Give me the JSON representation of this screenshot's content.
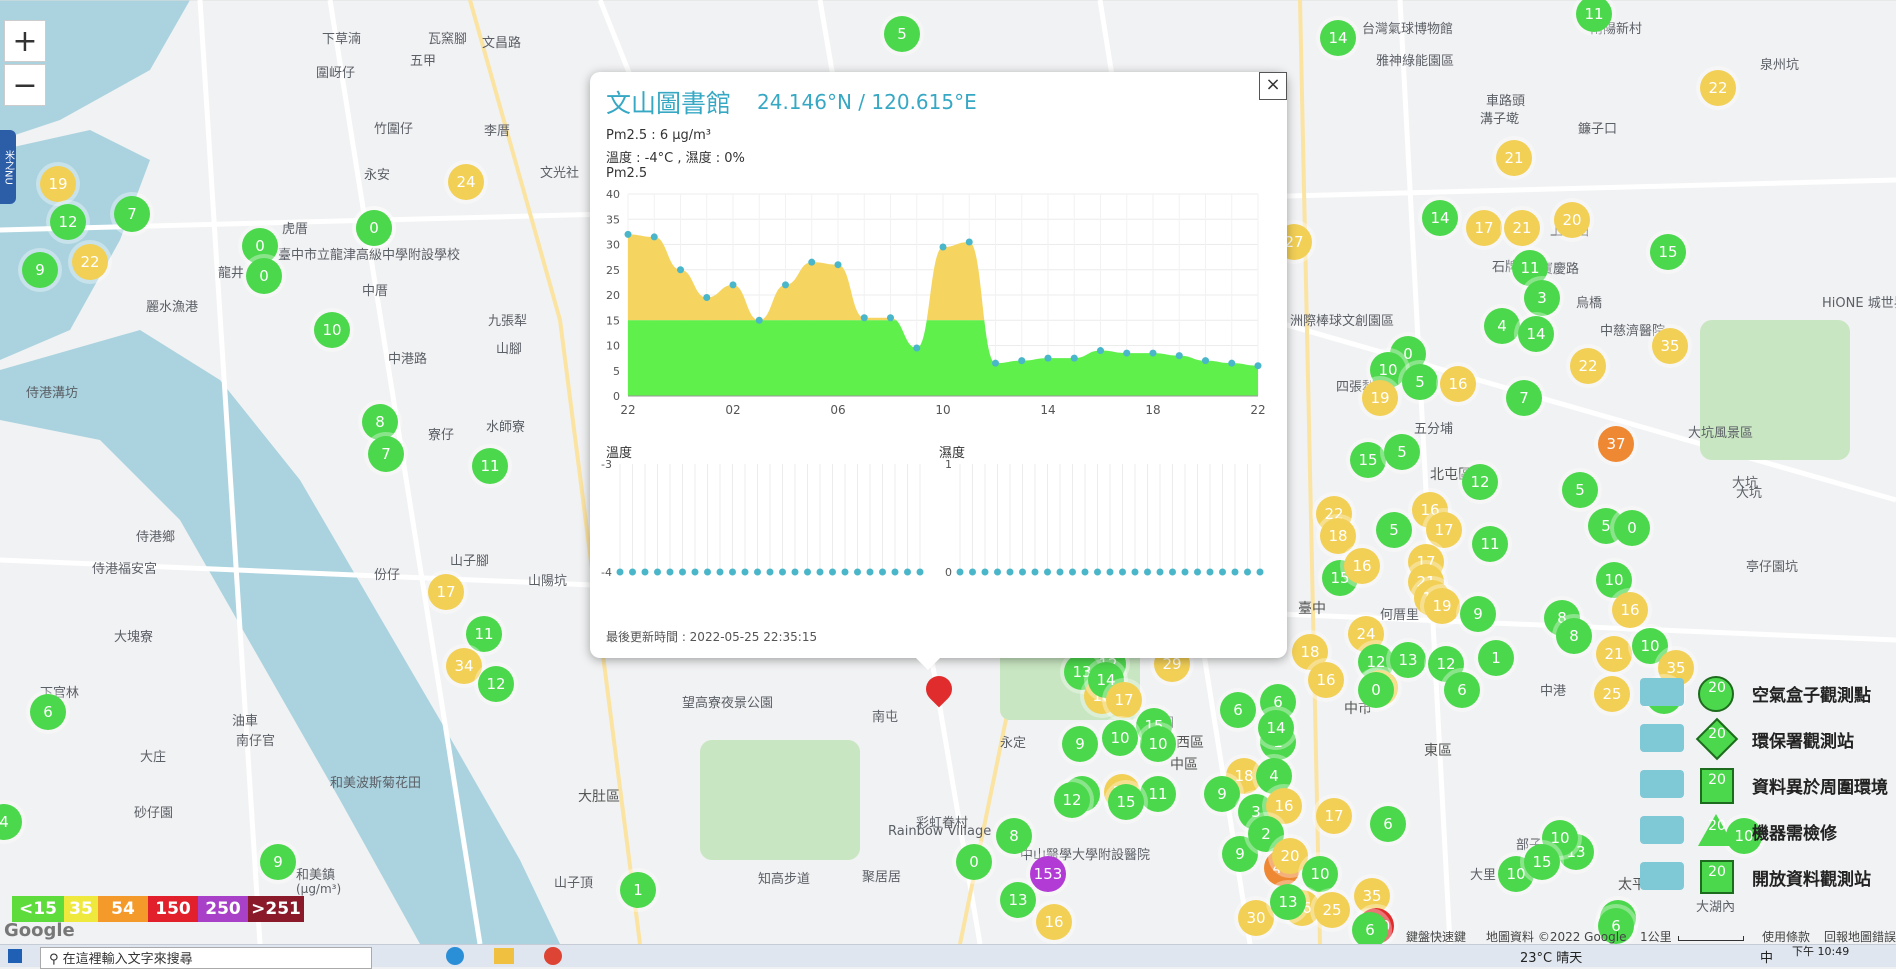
{
  "map": {
    "zoom_in": "+",
    "zoom_out": "−",
    "side_tab": "米之NU",
    "google": "Google",
    "attribution": {
      "road": "鍵盤快速鍵",
      "data": "地圖資料 ©2022 Google",
      "scale": "1公里",
      "terms": "使用條款",
      "report": "回報地圖錯誤"
    },
    "labels": [
      {
        "text": "下草湳"
      },
      {
        "text": "瓦窯腳"
      },
      {
        "text": "文昌路"
      },
      {
        "text": "五甲"
      },
      {
        "text": "圍岈仔"
      },
      {
        "text": "竹圍仔"
      },
      {
        "text": "李厝"
      },
      {
        "text": "永安"
      },
      {
        "text": "文光社"
      },
      {
        "text": "虎厝"
      },
      {
        "text": "龍井"
      },
      {
        "text": "中厝"
      },
      {
        "text": "九張犁"
      },
      {
        "text": "山腳"
      },
      {
        "text": "麗水漁港"
      },
      {
        "text": "中港路"
      },
      {
        "text": "侍港溝坊"
      },
      {
        "text": "水師寮"
      },
      {
        "text": "寮仔"
      },
      {
        "text": "山陽坑"
      },
      {
        "text": "侍港鄉"
      },
      {
        "text": "侍港福安宮"
      },
      {
        "text": "份仔"
      },
      {
        "text": "山子腳"
      },
      {
        "text": "大塊寮"
      },
      {
        "text": "下官林"
      },
      {
        "text": "油車"
      },
      {
        "text": "大庄"
      },
      {
        "text": "南仔官"
      },
      {
        "text": "砂仔園"
      },
      {
        "text": "和美波斯菊花田"
      },
      {
        "text": "和美鎮"
      },
      {
        "text": "大肚區"
      },
      {
        "text": "山子頂"
      },
      {
        "text": "望高寮夜景公園"
      },
      {
        "text": "彩虹眷村"
      },
      {
        "text": "Rainbow Village"
      },
      {
        "text": "聚居居"
      },
      {
        "text": "知高步道"
      },
      {
        "text": "南屯"
      },
      {
        "text": "永定"
      },
      {
        "text": "麻園"
      },
      {
        "text": "西區"
      },
      {
        "text": "中區"
      },
      {
        "text": "臺中"
      },
      {
        "text": "中市"
      },
      {
        "text": "東區"
      },
      {
        "text": "中山醫學大學附設醫院"
      },
      {
        "text": "何厝里"
      },
      {
        "text": "四張犁"
      },
      {
        "text": "北屯區"
      },
      {
        "text": "五分埔"
      },
      {
        "text": "上新田"
      },
      {
        "text": "烏橋"
      },
      {
        "text": "大坑風景區"
      },
      {
        "text": "大坑"
      },
      {
        "text": "亭仔園坑"
      },
      {
        "text": "南陽新村"
      },
      {
        "text": "泉州坑"
      },
      {
        "text": "台灣氣球博物館"
      },
      {
        "text": "雅神綠能園區"
      },
      {
        "text": "車路頭"
      },
      {
        "text": "溝子墘"
      },
      {
        "text": "鐮子口"
      },
      {
        "text": "生態農莊"
      },
      {
        "text": "洲際棒球文創園區"
      },
      {
        "text": "石牌公園"
      },
      {
        "text": "寶慶路"
      },
      {
        "text": "中慈濟醫院"
      },
      {
        "text": "HiONE 城世界"
      },
      {
        "text": "大湖內"
      },
      {
        "text": "太平區"
      },
      {
        "text": "部子"
      },
      {
        "text": "大里"
      },
      {
        "text": "臺中市立龍津高級中學附設學校"
      },
      {
        "text": "中港"
      },
      {
        "text": "大坑"
      }
    ],
    "markers": [
      {
        "v": "5",
        "c": "g"
      },
      {
        "v": "14",
        "c": "g"
      },
      {
        "v": "11",
        "c": "g"
      },
      {
        "v": "22",
        "c": "y"
      },
      {
        "v": "19",
        "c": "y"
      },
      {
        "v": "12",
        "c": "g"
      },
      {
        "v": "7",
        "c": "g"
      },
      {
        "v": "9",
        "c": "g"
      },
      {
        "v": "22",
        "c": "y"
      },
      {
        "v": "0",
        "c": "g"
      },
      {
        "v": "0",
        "c": "g"
      },
      {
        "v": "0",
        "c": "g"
      },
      {
        "v": "24",
        "c": "y"
      },
      {
        "v": "10",
        "c": "g"
      },
      {
        "v": "8",
        "c": "g"
      },
      {
        "v": "7",
        "c": "g"
      },
      {
        "v": "11",
        "c": "g"
      },
      {
        "v": "17",
        "c": "y"
      },
      {
        "v": "11",
        "c": "g"
      },
      {
        "v": "34",
        "c": "y"
      },
      {
        "v": "12",
        "c": "g"
      },
      {
        "v": "6",
        "c": "g"
      },
      {
        "v": "4",
        "c": "g"
      },
      {
        "v": "9",
        "c": "g"
      },
      {
        "v": "1",
        "c": "g"
      },
      {
        "v": "0",
        "c": "g"
      },
      {
        "v": "8",
        "c": "g"
      },
      {
        "v": "153",
        "c": "p"
      },
      {
        "v": "13",
        "c": "g"
      },
      {
        "v": "16",
        "c": "y"
      },
      {
        "v": "0",
        "c": "g"
      },
      {
        "v": "27",
        "c": "y"
      },
      {
        "v": "21",
        "c": "y"
      },
      {
        "v": "14",
        "c": "g"
      },
      {
        "v": "17",
        "c": "y"
      },
      {
        "v": "21",
        "c": "y"
      },
      {
        "v": "20",
        "c": "y"
      },
      {
        "v": "11",
        "c": "g"
      },
      {
        "v": "3",
        "c": "g"
      },
      {
        "v": "15",
        "c": "g"
      },
      {
        "v": "4",
        "c": "g"
      },
      {
        "v": "14",
        "c": "g"
      },
      {
        "v": "22",
        "c": "y"
      },
      {
        "v": "35",
        "c": "y"
      },
      {
        "v": "0",
        "c": "g"
      },
      {
        "v": "10",
        "c": "g"
      },
      {
        "v": "5",
        "c": "g"
      },
      {
        "v": "16",
        "c": "y"
      },
      {
        "v": "19",
        "c": "y"
      },
      {
        "v": "7",
        "c": "g"
      },
      {
        "v": "37",
        "c": "o"
      },
      {
        "v": "15",
        "c": "g"
      },
      {
        "v": "5",
        "c": "g"
      },
      {
        "v": "5",
        "c": "g"
      },
      {
        "v": "12",
        "c": "g"
      },
      {
        "v": "5",
        "c": "g"
      },
      {
        "v": "0",
        "c": "g"
      },
      {
        "v": "16",
        "c": "y"
      },
      {
        "v": "22",
        "c": "y"
      },
      {
        "v": "18",
        "c": "y"
      },
      {
        "v": "5",
        "c": "g"
      },
      {
        "v": "17",
        "c": "y"
      },
      {
        "v": "11",
        "c": "g"
      },
      {
        "v": "15",
        "c": "g"
      },
      {
        "v": "16",
        "c": "y"
      },
      {
        "v": "17",
        "c": "y"
      },
      {
        "v": "21",
        "c": "y"
      },
      {
        "v": "18",
        "c": "y"
      },
      {
        "v": "19",
        "c": "y"
      },
      {
        "v": "9",
        "c": "g"
      },
      {
        "v": "8",
        "c": "g"
      },
      {
        "v": "10",
        "c": "g"
      },
      {
        "v": "16",
        "c": "y"
      },
      {
        "v": "24",
        "c": "y"
      },
      {
        "v": "18",
        "c": "y"
      },
      {
        "v": "16",
        "c": "y"
      },
      {
        "v": "12",
        "c": "g"
      },
      {
        "v": "13",
        "c": "g"
      },
      {
        "v": "12",
        "c": "g"
      },
      {
        "v": "1",
        "c": "g"
      },
      {
        "v": "8",
        "c": "g"
      },
      {
        "v": "21",
        "c": "y"
      },
      {
        "v": "10",
        "c": "g"
      },
      {
        "v": "35",
        "c": "y"
      },
      {
        "v": "24",
        "c": "y"
      },
      {
        "v": "0",
        "c": "g"
      },
      {
        "v": "6",
        "c": "g"
      },
      {
        "v": "25",
        "c": "y"
      },
      {
        "v": "12",
        "c": "g"
      },
      {
        "v": "12",
        "c": "g"
      },
      {
        "v": "13",
        "c": "g"
      },
      {
        "v": "18",
        "c": "y"
      },
      {
        "v": "29",
        "c": "y"
      },
      {
        "v": "14",
        "c": "g"
      },
      {
        "v": "17",
        "c": "y"
      },
      {
        "v": "6",
        "c": "g"
      },
      {
        "v": "6",
        "c": "g"
      },
      {
        "v": "15",
        "c": "g"
      },
      {
        "v": "10",
        "c": "g"
      },
      {
        "v": "1",
        "c": "g"
      },
      {
        "v": "14",
        "c": "g"
      },
      {
        "v": "10",
        "c": "g"
      },
      {
        "v": "9",
        "c": "g"
      },
      {
        "v": "18",
        "c": "y"
      },
      {
        "v": "4",
        "c": "g"
      },
      {
        "v": "8",
        "c": "g"
      },
      {
        "v": "12",
        "c": "g"
      },
      {
        "v": "17",
        "c": "y"
      },
      {
        "v": "11",
        "c": "g"
      },
      {
        "v": "9",
        "c": "g"
      },
      {
        "v": "3",
        "c": "g"
      },
      {
        "v": "16",
        "c": "y"
      },
      {
        "v": "17",
        "c": "y"
      },
      {
        "v": "6",
        "c": "g"
      },
      {
        "v": "15",
        "c": "g"
      },
      {
        "v": "9",
        "c": "g"
      },
      {
        "v": "2",
        "c": "g"
      },
      {
        "v": "43",
        "c": "o"
      },
      {
        "v": "20",
        "c": "y"
      },
      {
        "v": "10",
        "c": "g"
      },
      {
        "v": "16",
        "c": "y"
      },
      {
        "v": "30",
        "c": "y"
      },
      {
        "v": "13",
        "c": "g"
      },
      {
        "v": "25",
        "c": "y"
      },
      {
        "v": "35",
        "c": "y"
      },
      {
        "v": "130",
        "c": "r"
      },
      {
        "v": "10",
        "c": "g"
      },
      {
        "v": "13",
        "c": "g"
      },
      {
        "v": "12",
        "c": "g"
      },
      {
        "v": "6",
        "c": "g"
      },
      {
        "v": "10",
        "c": "g"
      },
      {
        "v": "10",
        "c": "g"
      },
      {
        "v": "15",
        "c": "g"
      },
      {
        "v": "6",
        "c": "g"
      }
    ]
  },
  "popup": {
    "title": "文山圖書館",
    "coord": "24.146°N / 120.615°E",
    "pm_line": "Pm2.5 : 6 μg/m³",
    "temp_line": "溫度 : -4°C , 濕度 : 0%",
    "chart_title": "Pm2.5",
    "close": "×",
    "updated": "最後更新時間 : 2022-05-25 22:35:15",
    "temp_label": "溫度",
    "hum_label": "濕度"
  },
  "chart_data": [
    {
      "type": "area",
      "title": "Pm2.5",
      "x": [
        "22",
        "23",
        "00",
        "01",
        "02",
        "03",
        "04",
        "05",
        "06",
        "07",
        "08",
        "09",
        "10",
        "11",
        "12",
        "13",
        "14",
        "15",
        "16",
        "17",
        "18",
        "19",
        "20",
        "21",
        "22"
      ],
      "xticks": [
        "22",
        "02",
        "06",
        "10",
        "14",
        "18",
        "22"
      ],
      "values": [
        32,
        31.5,
        25,
        19.5,
        22,
        15,
        22,
        26.5,
        26,
        15.5,
        15.5,
        9.5,
        29.5,
        30.5,
        6.5,
        7,
        7.5,
        7.5,
        9,
        8.5,
        8.5,
        8,
        7,
        6.5,
        6
      ],
      "yticks": [
        0,
        5,
        10,
        15,
        20,
        25,
        30,
        35,
        40
      ],
      "ylim": [
        0,
        40
      ],
      "threshold": 15,
      "colors": {
        "below": "#5ff04c",
        "above": "#f5d560",
        "point": "#4ab6c9"
      },
      "grid": true
    },
    {
      "type": "line",
      "title": "溫度",
      "values": [
        -4,
        -4,
        -4,
        -4,
        -4,
        -4,
        -4,
        -4,
        -4,
        -4,
        -4,
        -4,
        -4,
        -4,
        -4,
        -4,
        -4,
        -4,
        -4,
        -4,
        -4,
        -4,
        -4,
        -4,
        -4
      ],
      "yticks": [
        -3,
        -4
      ],
      "ylim": [
        -4,
        -3
      ],
      "color": "#4ab6c9"
    },
    {
      "type": "line",
      "title": "濕度",
      "values": [
        0,
        0,
        0,
        0,
        0,
        0,
        0,
        0,
        0,
        0,
        0,
        0,
        0,
        0,
        0,
        0,
        0,
        0,
        0,
        0,
        0,
        0,
        0,
        0,
        0
      ],
      "yticks": [
        1,
        0
      ],
      "ylim": [
        0,
        1
      ],
      "color": "#4ab6c9"
    }
  ],
  "legend": {
    "sample": "20",
    "items": [
      {
        "label": "空氣盒子觀測點",
        "shape": "circle"
      },
      {
        "label": "環保署觀測站",
        "shape": "diamond"
      },
      {
        "label": "資料異於周圍環境",
        "shape": "house"
      },
      {
        "label": "機器需檢修",
        "shape": "triangle"
      },
      {
        "label": "開放資料觀測站",
        "shape": "square"
      }
    ]
  },
  "scale": {
    "items": [
      {
        "label": "<15",
        "color": "#5ddc3c"
      },
      {
        "label": "35",
        "color": "#f0e93d"
      },
      {
        "label": "54",
        "color": "#f39a2b"
      },
      {
        "label": "150",
        "color": "#e2202c"
      },
      {
        "label": "250",
        "color": "#a940c8"
      },
      {
        "label": ">251",
        "color": "#8a1a2a"
      }
    ],
    "unit": "(μg/m³)"
  },
  "taskbar": {
    "search_placeholder": "在這裡輸入文字來搜尋",
    "weather": "23°C 晴天",
    "ime": "中",
    "time": "下午 10:49"
  }
}
